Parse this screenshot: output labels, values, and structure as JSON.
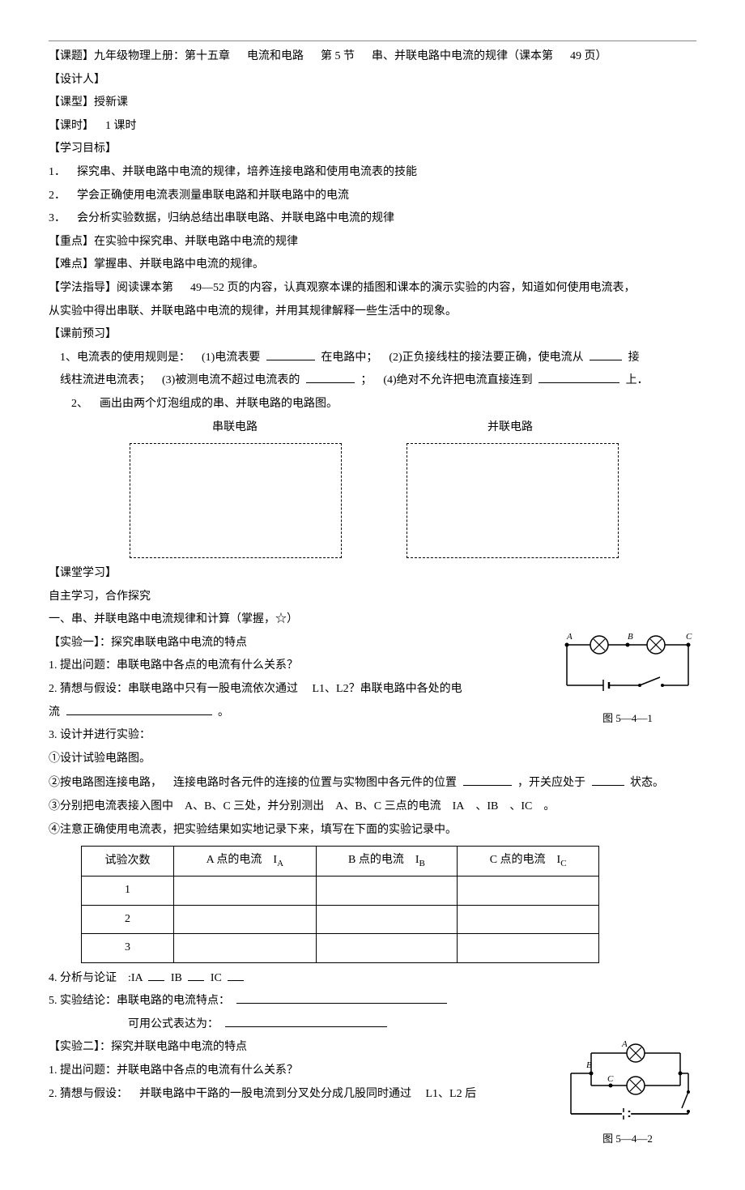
{
  "header": {
    "topic": "【课题】九年级物理上册：第十五章   电流和电路   第 5 节   串、并联电路中电流的规律（课本第   49 页）",
    "designer": "【设计人】",
    "lesson_type": "【课型】授新课",
    "periods": "【课时】 1 课时",
    "objectives_label": "【学习目标】",
    "obj1": "1． 探究串、并联电路中电流的规律，培养连接电路和使用电流表的技能",
    "obj2": "2． 学会正确使用电流表测量串联电路和并联电路中的电流",
    "obj3": "3． 会分析实验数据，归纳总结出串联电路、并联电路中电流的规律",
    "key_point": "【重点】在实验中探究串、并联电路中电流的规律",
    "difficulty": "【难点】掌握串、并联电路中电流的规律。",
    "method_a": "【学法指导】阅读课本第   49—52 页的内容，认真观察本课的插图和课本的演示实验的内容，知道如何使用电流表，",
    "method_b": "从实验中得出串联、并联电路中电流的规律，并用其规律解释一些生活中的现象。"
  },
  "preview": {
    "label": "【课前预习】",
    "q1_a": "1、电流表的使用规则是： (1)电流表要",
    "q1_b": "在电路中； (2)正负接线柱的接法要正确，使电流从",
    "q1_c": "接",
    "q1_d": "线柱流进电流表； (3)被测电流不超过电流表的",
    "q1_e": "； (4)绝对不允许把电流直接连到",
    "q1_f": "上．",
    "q2": "2、 画出由两个灯泡组成的串、并联电路的电路图。",
    "series_label": "串联电路",
    "parallel_label": "并联电路"
  },
  "classroom": {
    "label": "【课堂学习】",
    "sub1": "自主学习，合作探究",
    "section1": "一、串、并联电路中电流规律和计算（掌握，☆）",
    "exp1_label": "【实验一】：探究串联电路中电流的特点",
    "e1_1": "1. 提出问题：串联电路中各点的电流有什么关系？",
    "e1_2a": "2. 猜想与假设：串联电路中只有一股电流依次通过",
    "e1_2b": "L1、L2？串联电路中各处的电",
    "e1_2c": "流",
    "e1_2d": "。",
    "e1_3": "3. 设计并进行实验：",
    "e1_3_1": "①设计试验电路图。",
    "e1_3_2a": "②按电路图连接电路， 连接电路时各元件的连接的位置与实物图中各元件的位置",
    "e1_3_2b": "，开关应处于",
    "e1_3_2c": "状态。",
    "e1_3_3": "③分别把电流表接入图中 A、B、C 三处，并分别测出 A、B、C 三点的电流 IA 、IB 、IC 。",
    "e1_3_4": "④注意正确使用电流表，把实验结果如实地记录下来，填写在下面的实验记录中。",
    "table": {
      "h1": "试验次数",
      "h2a": "A 点的电流 I",
      "h2b": "A",
      "h3a": "B 点的电流 I",
      "h3b": "B",
      "h4a": "C 点的电流 I",
      "h4b": "C",
      "r1": "1",
      "r2": "2",
      "r3": "3"
    },
    "e1_4a": "4. 分析与论证 :IA",
    "e1_4b": "IB",
    "e1_4c": "IC",
    "e1_5a": "5. 实验结论：串联电路的电流特点：",
    "e1_5b": "可用公式表达为：",
    "exp2_label": "【实验二】：探究并联电路中电流的特点",
    "e2_1": "1. 提出问题：并联电路中各点的电流有什么关系？",
    "e2_2a": "2. 猜想与假设： 并联电路中干路的一股电流到分叉处分成几股同时通过",
    "e2_2b": "L1、L2 后"
  },
  "figures": {
    "fig1_caption": "图 5—4—1",
    "fig2_caption": "图 5—4—2"
  }
}
